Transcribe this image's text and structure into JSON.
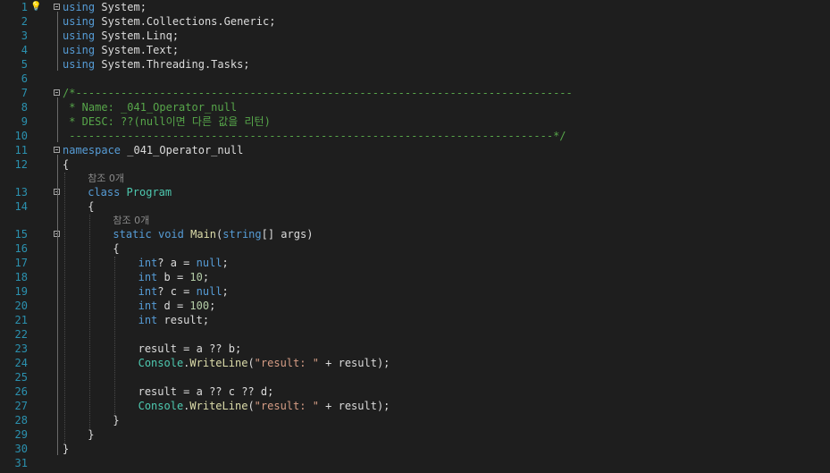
{
  "editor": {
    "lines": [
      {
        "num": "1",
        "tokens": [
          [
            "kw",
            "using"
          ],
          [
            "nm",
            " System;"
          ]
        ],
        "indent": 0
      },
      {
        "num": "2",
        "tokens": [
          [
            "kw",
            "using"
          ],
          [
            "nm",
            " System.Collections.Generic;"
          ]
        ],
        "indent": 0
      },
      {
        "num": "3",
        "tokens": [
          [
            "kw",
            "using"
          ],
          [
            "nm",
            " System.Linq;"
          ]
        ],
        "indent": 0
      },
      {
        "num": "4",
        "tokens": [
          [
            "kw",
            "using"
          ],
          [
            "nm",
            " System.Text;"
          ]
        ],
        "indent": 0
      },
      {
        "num": "5",
        "tokens": [
          [
            "kw",
            "using"
          ],
          [
            "nm",
            " System.Threading.Tasks;"
          ]
        ],
        "indent": 0
      },
      {
        "num": "6",
        "tokens": [],
        "indent": 0
      },
      {
        "num": "7",
        "tokens": [
          [
            "cm",
            "/*-----------------------------------------------------------------------------"
          ]
        ],
        "indent": 0
      },
      {
        "num": "8",
        "tokens": [
          [
            "cm",
            " * Name: _041_Operator_null"
          ]
        ],
        "indent": 0
      },
      {
        "num": "9",
        "tokens": [
          [
            "cm",
            " * DESC: ??(null이면 다른 값을 리턴)"
          ]
        ],
        "indent": 0
      },
      {
        "num": "10",
        "tokens": [
          [
            "cm",
            " ---------------------------------------------------------------------------*/"
          ]
        ],
        "indent": 0
      },
      {
        "num": "11",
        "tokens": [
          [
            "kw",
            "namespace"
          ],
          [
            "nm",
            " _041_Operator_null"
          ]
        ],
        "indent": 0
      },
      {
        "num": "12",
        "tokens": [
          [
            "nm",
            "{"
          ]
        ],
        "indent": 0
      },
      {
        "num": "",
        "lens": "참조 0개",
        "indent": 4
      },
      {
        "num": "13",
        "tokens": [
          [
            "kw",
            "class"
          ],
          [
            "nm",
            " "
          ],
          [
            "ty",
            "Program"
          ]
        ],
        "indent": 4
      },
      {
        "num": "14",
        "tokens": [
          [
            "nm",
            "{"
          ]
        ],
        "indent": 4
      },
      {
        "num": "",
        "lens": "참조 0개",
        "indent": 8
      },
      {
        "num": "15",
        "tokens": [
          [
            "kw",
            "static"
          ],
          [
            "nm",
            " "
          ],
          [
            "kw",
            "void"
          ],
          [
            "nm",
            " "
          ],
          [
            "fn",
            "Main"
          ],
          [
            "nm",
            "("
          ],
          [
            "kw",
            "string"
          ],
          [
            "nm",
            "[] args)"
          ]
        ],
        "indent": 8
      },
      {
        "num": "16",
        "tokens": [
          [
            "nm",
            "{"
          ]
        ],
        "indent": 8
      },
      {
        "num": "17",
        "tokens": [
          [
            "kw",
            "int"
          ],
          [
            "nm",
            "? a = "
          ],
          [
            "kw",
            "null"
          ],
          [
            "nm",
            ";"
          ]
        ],
        "indent": 12
      },
      {
        "num": "18",
        "tokens": [
          [
            "kw",
            "int"
          ],
          [
            "nm",
            " b = "
          ],
          [
            "num",
            "10"
          ],
          [
            "nm",
            ";"
          ]
        ],
        "indent": 12
      },
      {
        "num": "19",
        "tokens": [
          [
            "kw",
            "int"
          ],
          [
            "nm",
            "? c = "
          ],
          [
            "kw",
            "null"
          ],
          [
            "nm",
            ";"
          ]
        ],
        "indent": 12
      },
      {
        "num": "20",
        "tokens": [
          [
            "kw",
            "int"
          ],
          [
            "nm",
            " d = "
          ],
          [
            "num",
            "100"
          ],
          [
            "nm",
            ";"
          ]
        ],
        "indent": 12
      },
      {
        "num": "21",
        "tokens": [
          [
            "kw",
            "int"
          ],
          [
            "nm",
            " result;"
          ]
        ],
        "indent": 12
      },
      {
        "num": "22",
        "tokens": [],
        "indent": 12
      },
      {
        "num": "23",
        "tokens": [
          [
            "nm",
            "result = a ?? b;"
          ]
        ],
        "indent": 12
      },
      {
        "num": "24",
        "tokens": [
          [
            "ty",
            "Console"
          ],
          [
            "nm",
            "."
          ],
          [
            "fn",
            "WriteLine"
          ],
          [
            "nm",
            "("
          ],
          [
            "st",
            "\"result: \""
          ],
          [
            "nm",
            " + result);"
          ]
        ],
        "indent": 12
      },
      {
        "num": "25",
        "tokens": [],
        "indent": 12
      },
      {
        "num": "26",
        "tokens": [
          [
            "nm",
            "result = a ?? c ?? d;"
          ]
        ],
        "indent": 12
      },
      {
        "num": "27",
        "tokens": [
          [
            "ty",
            "Console"
          ],
          [
            "nm",
            "."
          ],
          [
            "fn",
            "WriteLine"
          ],
          [
            "nm",
            "("
          ],
          [
            "st",
            "\"result: \""
          ],
          [
            "nm",
            " + result);"
          ]
        ],
        "indent": 12
      },
      {
        "num": "28",
        "tokens": [
          [
            "nm",
            "}"
          ]
        ],
        "indent": 8
      },
      {
        "num": "29",
        "tokens": [
          [
            "nm",
            "}"
          ]
        ],
        "indent": 4
      },
      {
        "num": "30",
        "tokens": [
          [
            "nm",
            "}"
          ]
        ],
        "indent": 0
      },
      {
        "num": "31",
        "tokens": [],
        "indent": 0
      }
    ],
    "fold_lines": [
      "1",
      "7",
      "11",
      "13",
      "15"
    ],
    "lightbulb_line": "1",
    "colors": {
      "background": "#1e1e1e",
      "line_number": "#2b91af",
      "keyword": "#569cd6",
      "type": "#4ec9b0",
      "string": "#d69d85",
      "comment": "#57a64a",
      "method": "#dcdcaa",
      "number": "#b5cea8",
      "identifier": "#dcdcdc"
    },
    "icons": {
      "lightbulb": "lightbulb-icon",
      "fold": "collapse-icon"
    }
  }
}
